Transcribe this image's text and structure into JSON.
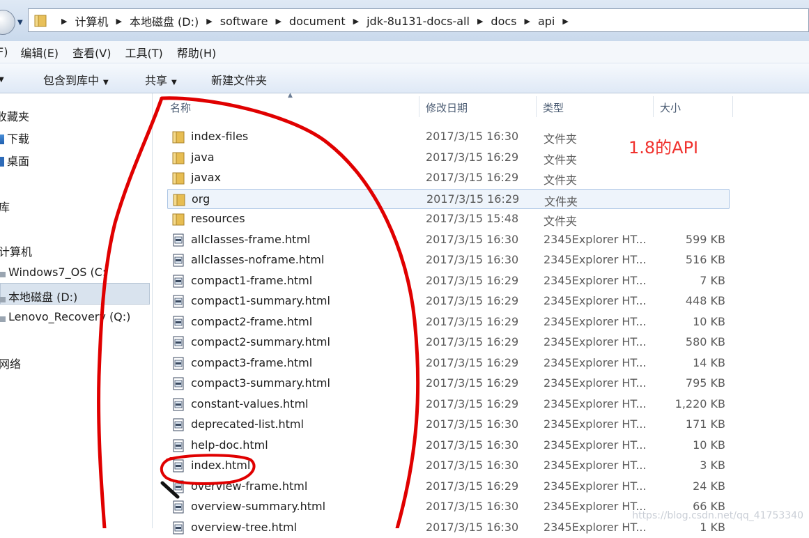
{
  "address_bar": {
    "breadcrumbs": [
      "计算机",
      "本地磁盘 (D:)",
      "software",
      "document",
      "jdk-8u131-docs-all",
      "docs",
      "api"
    ]
  },
  "menu": [
    "F)",
    "编辑(E)",
    "查看(V)",
    "工具(T)",
    "帮助(H)"
  ],
  "toolbar": {
    "include_library": "包含到库中",
    "share": "共享",
    "new_folder": "新建文件夹"
  },
  "nav": {
    "favorites": "收藏夹",
    "downloads": "下载",
    "desktop": "桌面",
    "libraries": "库",
    "computer": "计算机",
    "drive_c": "Windows7_OS (C:",
    "drive_d": "本地磁盘 (D:)",
    "drive_q": "Lenovo_Recovery (Q:)",
    "network": "网络"
  },
  "columns": {
    "name": "名称",
    "date": "修改日期",
    "type": "类型",
    "size": "大小"
  },
  "files": [
    {
      "name": "index-files",
      "date": "2017/3/15 16:30",
      "type": "文件夹",
      "size": "",
      "kind": "folder"
    },
    {
      "name": "java",
      "date": "2017/3/15 16:29",
      "type": "文件夹",
      "size": "",
      "kind": "folder"
    },
    {
      "name": "javax",
      "date": "2017/3/15 16:29",
      "type": "文件夹",
      "size": "",
      "kind": "folder"
    },
    {
      "name": "org",
      "date": "2017/3/15 16:29",
      "type": "文件夹",
      "size": "",
      "kind": "folder",
      "selected": true
    },
    {
      "name": "resources",
      "date": "2017/3/15 15:48",
      "type": "文件夹",
      "size": "",
      "kind": "folder"
    },
    {
      "name": "allclasses-frame.html",
      "date": "2017/3/15 16:30",
      "type": "2345Explorer HT...",
      "size": "599 KB",
      "kind": "html"
    },
    {
      "name": "allclasses-noframe.html",
      "date": "2017/3/15 16:30",
      "type": "2345Explorer HT...",
      "size": "516 KB",
      "kind": "html"
    },
    {
      "name": "compact1-frame.html",
      "date": "2017/3/15 16:29",
      "type": "2345Explorer HT...",
      "size": "7 KB",
      "kind": "html"
    },
    {
      "name": "compact1-summary.html",
      "date": "2017/3/15 16:29",
      "type": "2345Explorer HT...",
      "size": "448 KB",
      "kind": "html"
    },
    {
      "name": "compact2-frame.html",
      "date": "2017/3/15 16:29",
      "type": "2345Explorer HT...",
      "size": "10 KB",
      "kind": "html"
    },
    {
      "name": "compact2-summary.html",
      "date": "2017/3/15 16:29",
      "type": "2345Explorer HT...",
      "size": "580 KB",
      "kind": "html"
    },
    {
      "name": "compact3-frame.html",
      "date": "2017/3/15 16:29",
      "type": "2345Explorer HT...",
      "size": "14 KB",
      "kind": "html"
    },
    {
      "name": "compact3-summary.html",
      "date": "2017/3/15 16:29",
      "type": "2345Explorer HT...",
      "size": "795 KB",
      "kind": "html"
    },
    {
      "name": "constant-values.html",
      "date": "2017/3/15 16:29",
      "type": "2345Explorer HT...",
      "size": "1,220 KB",
      "kind": "html"
    },
    {
      "name": "deprecated-list.html",
      "date": "2017/3/15 16:30",
      "type": "2345Explorer HT...",
      "size": "171 KB",
      "kind": "html"
    },
    {
      "name": "help-doc.html",
      "date": "2017/3/15 16:30",
      "type": "2345Explorer HT...",
      "size": "10 KB",
      "kind": "html"
    },
    {
      "name": "index.html",
      "date": "2017/3/15 16:30",
      "type": "2345Explorer HT...",
      "size": "3 KB",
      "kind": "html"
    },
    {
      "name": "overview-frame.html",
      "date": "2017/3/15 16:29",
      "type": "2345Explorer HT...",
      "size": "24 KB",
      "kind": "html"
    },
    {
      "name": "overview-summary.html",
      "date": "2017/3/15 16:30",
      "type": "2345Explorer HT...",
      "size": "66 KB",
      "kind": "html"
    },
    {
      "name": "overview-tree.html",
      "date": "2017/3/15 16:30",
      "type": "2345Explorer HT...",
      "size": "1 KB",
      "kind": "html"
    }
  ],
  "annotation_label": "1.8的API",
  "watermark": "https://blog.csdn.net/qq_41753340",
  "colors": {
    "annotation": "#e00000",
    "label": "#f0322e"
  }
}
